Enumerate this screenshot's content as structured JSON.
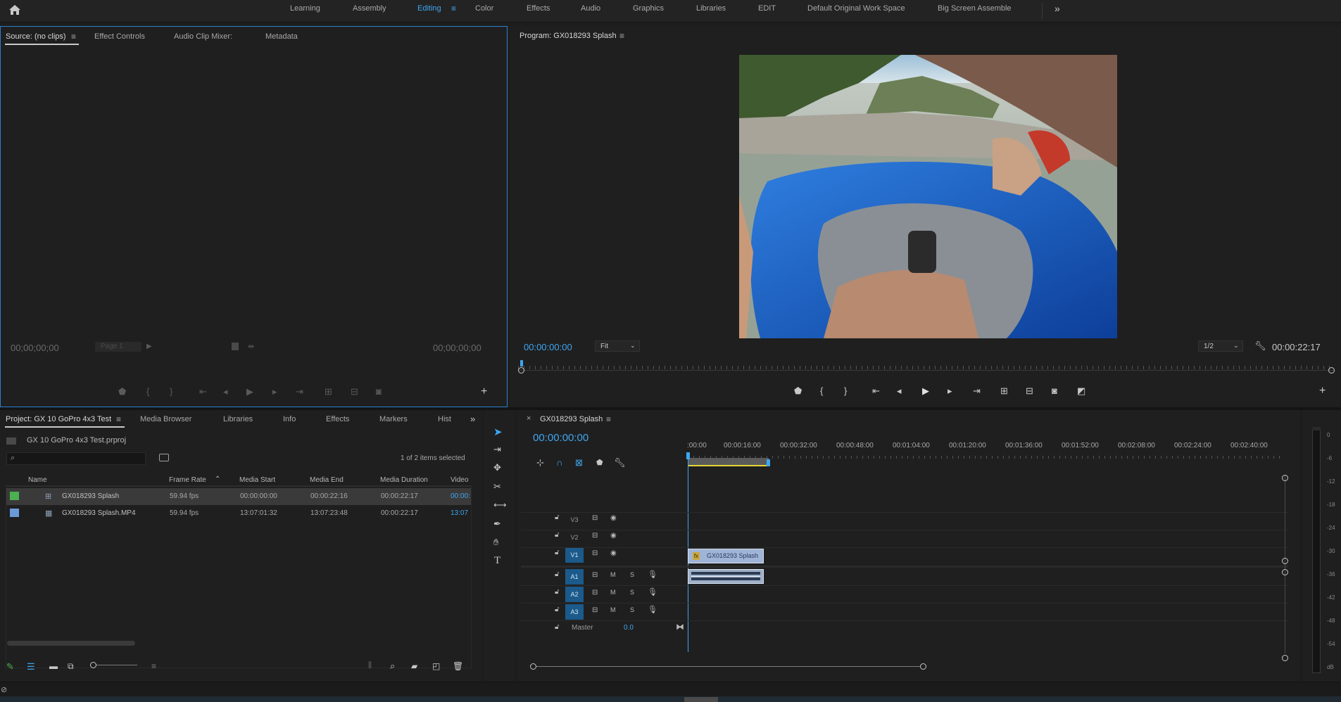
{
  "workspace": {
    "home_icon": "home-icon",
    "tabs": [
      "Learning",
      "Assembly",
      "Editing",
      "Color",
      "Effects",
      "Audio",
      "Graphics",
      "Libraries",
      "EDIT",
      "Default Original Work Space",
      "Big Screen Assemble"
    ],
    "active_tab": "Editing",
    "overflow_icon": "chevrons-right-icon"
  },
  "source": {
    "tabs": [
      "Source: (no clips)",
      "Effect Controls",
      "Audio Clip Mixer:",
      "Metadata"
    ],
    "timecode_left": "00;00;00;00",
    "page_label": "Page 1",
    "timecode_right": "00;00;00;00"
  },
  "program": {
    "title": "Program: GX018293 Splash",
    "timecode": "00:00:00:00",
    "fit_label": "Fit",
    "resolution_label": "1/2",
    "duration": "00:00:22:17"
  },
  "project": {
    "tabs": [
      "Project: GX 10 GoPro 4x3 Test",
      "Media Browser",
      "Libraries",
      "Info",
      "Effects",
      "Markers",
      "Hist"
    ],
    "file_name": "GX 10 GoPro 4x3 Test.prproj",
    "search_placeholder": "",
    "selection_status": "1 of 2 items selected",
    "columns": [
      "Name",
      "Frame Rate",
      "Media Start",
      "Media End",
      "Media Duration",
      "Video"
    ],
    "rows": [
      {
        "name": "GX018293 Splash",
        "frame_rate": "59.94 fps",
        "media_start": "00:00:00:00",
        "media_end": "00:00:22:16",
        "media_duration": "00:00:22:17",
        "video": "00:00:",
        "color": "#4caf50"
      },
      {
        "name": "GX018293 Splash.MP4",
        "frame_rate": "59.94 fps",
        "media_start": "13:07:01:32",
        "media_end": "13:07:23:48",
        "media_duration": "00:00:22:17",
        "video": "13:07",
        "color": "#6a9bd8"
      }
    ]
  },
  "timeline": {
    "sequence_name": "GX018293 Splash",
    "timecode": "00:00:00:00",
    "ruler": [
      ":00:00",
      "00:00:16:00",
      "00:00:32:00",
      "00:00:48:00",
      "00:01:04:00",
      "00:01:20:00",
      "00:01:36:00",
      "00:01:52:00",
      "00:02:08:00",
      "00:02:24:00",
      "00:02:40:00"
    ],
    "video_tracks": [
      "V3",
      "V2",
      "V1"
    ],
    "audio_tracks": [
      "A1",
      "A2",
      "A3"
    ],
    "master_label": "Master",
    "master_value": "0.0",
    "clip_name": "GX018293 Splash",
    "fx_label": "fx",
    "mute_label": "M",
    "solo_label": "S"
  },
  "audio_meter": {
    "labels": [
      "0",
      "-6",
      "-12",
      "-18",
      "-24",
      "-30",
      "-36",
      "-42",
      "-48",
      "-54",
      "dB"
    ]
  }
}
